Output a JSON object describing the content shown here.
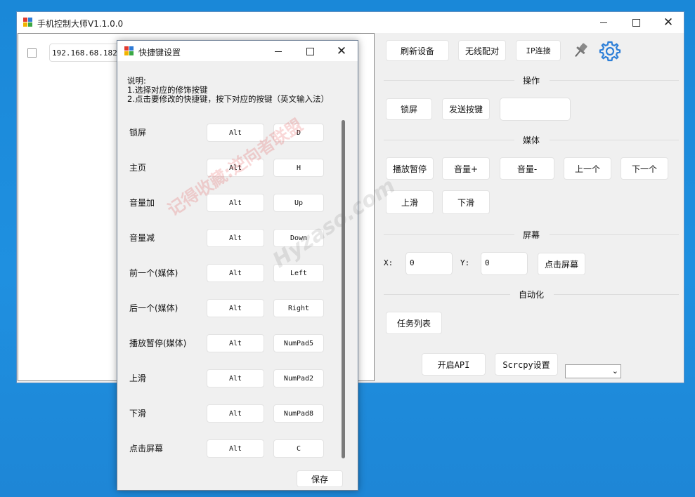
{
  "main_window": {
    "title": "手机控制大师V1.1.0.0",
    "device_ip": "192.168.68.182:4",
    "buttons": {
      "refresh": "刷新设备",
      "wireless_pair": "无线配对",
      "ip_connect": "IP连接",
      "lock_screen": "锁屏",
      "send_key": "发送按键",
      "play_pause": "播放暂停",
      "vol_up": "音量+",
      "vol_down": "音量-",
      "prev": "上一个",
      "next": "下一个",
      "swipe_up": "上滑",
      "swipe_down": "下滑",
      "click_screen": "点击屏幕",
      "task_list": "任务列表",
      "open_api": "开启API",
      "scrcpy_settings": "Scrcpy设置"
    },
    "sections": {
      "operation": "操作",
      "media": "媒体",
      "screen": "屏幕",
      "automation": "自动化"
    },
    "screen": {
      "x_label": "X:",
      "x_value": "0",
      "y_label": "Y:",
      "y_value": "0"
    },
    "send_key_value": "",
    "combo_value": ""
  },
  "dialog": {
    "title": "快捷键设置",
    "instructions": [
      "说明:",
      "1.选择对应的修饰按键",
      "2.点击要修改的快捷键，按下对应的按键（英文输入法）"
    ],
    "rows": [
      {
        "label": "锁屏",
        "modifier": "Alt",
        "key": "D"
      },
      {
        "label": "主页",
        "modifier": "Alt",
        "key": "H"
      },
      {
        "label": "音量加",
        "modifier": "Alt",
        "key": "Up"
      },
      {
        "label": "音量减",
        "modifier": "Alt",
        "key": "Down"
      },
      {
        "label": "前一个(媒体)",
        "modifier": "Alt",
        "key": "Left"
      },
      {
        "label": "后一个(媒体)",
        "modifier": "Alt",
        "key": "Right"
      },
      {
        "label": "播放暂停(媒体)",
        "modifier": "Alt",
        "key": "NumPad5"
      },
      {
        "label": "上滑",
        "modifier": "Alt",
        "key": "NumPad2"
      },
      {
        "label": "下滑",
        "modifier": "Alt",
        "key": "NumPad8"
      },
      {
        "label": "点击屏幕",
        "modifier": "Alt",
        "key": "C"
      }
    ],
    "save_label": "保存"
  },
  "watermark": {
    "text": "记得收藏:逆向者联盟",
    "site": "Hyzaso.com"
  },
  "colors": {
    "desktop": "#1f8fe0",
    "gear": "#2d7fd8"
  },
  "icons": {
    "pin": "pin-icon",
    "gear": "gear-icon"
  }
}
